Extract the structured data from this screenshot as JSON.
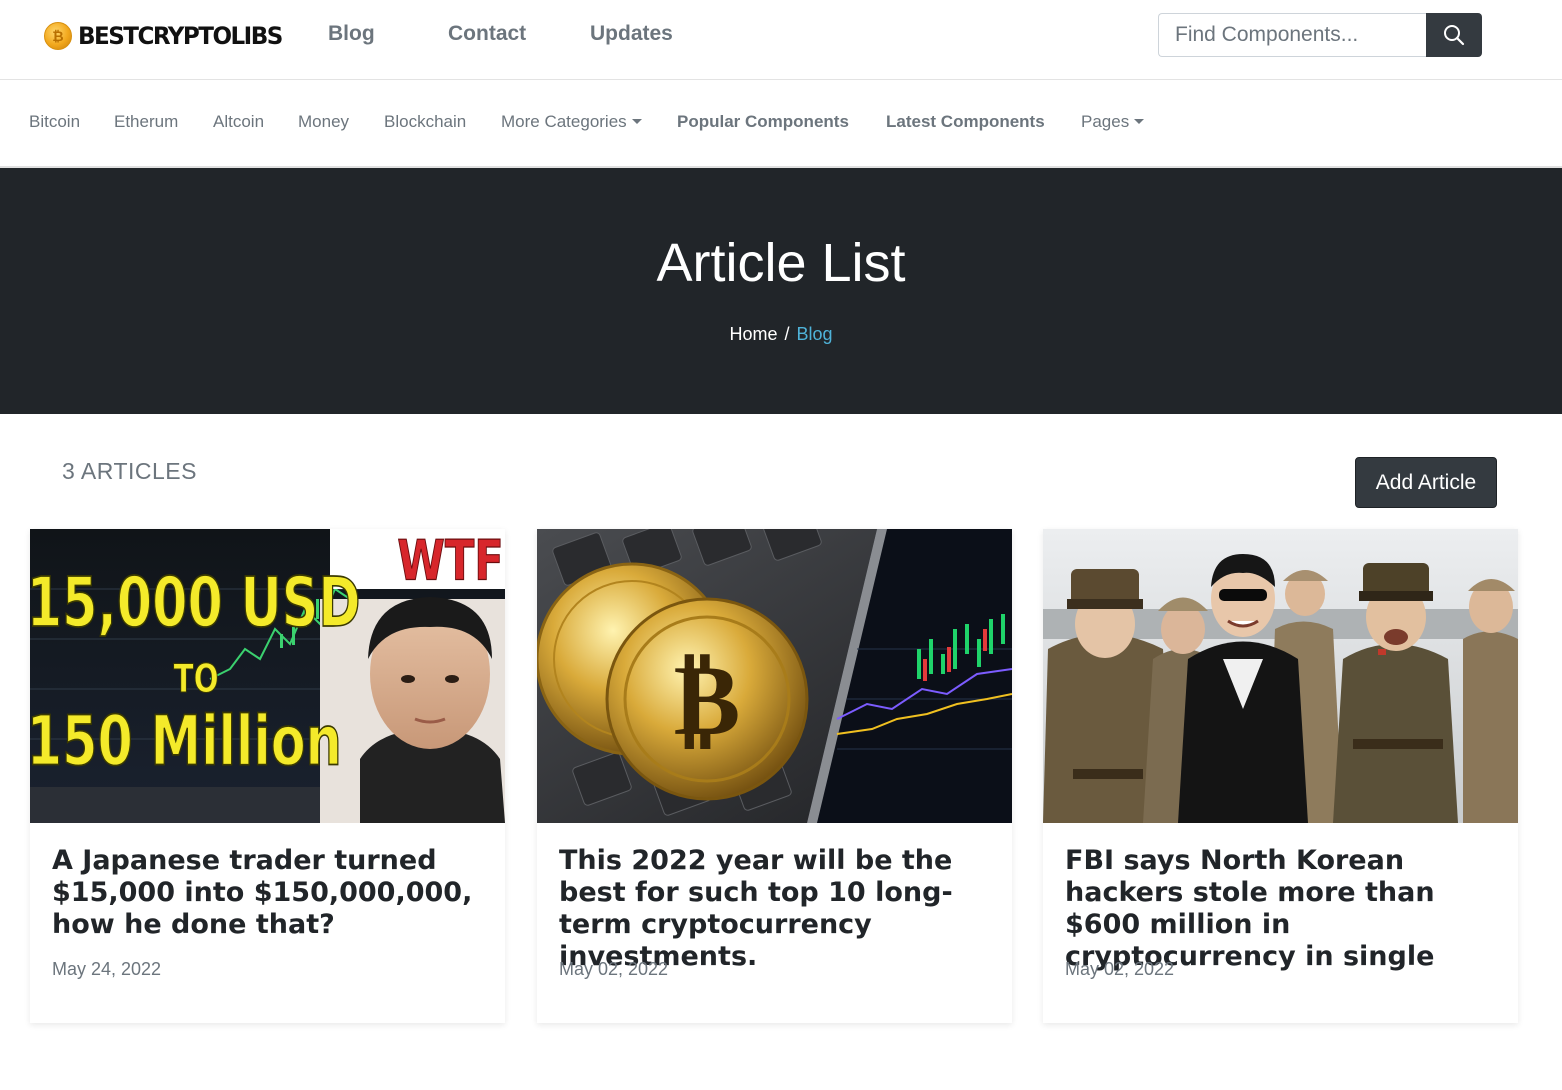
{
  "brand": {
    "name": "BESTCRYPTOLIBS",
    "coin_color": "#f2a81d"
  },
  "topnav": [
    {
      "label": "Blog"
    },
    {
      "label": "Contact"
    },
    {
      "label": "Updates"
    }
  ],
  "search": {
    "placeholder": "Find Components...",
    "value": "",
    "icon": "search-icon"
  },
  "catnav": [
    {
      "label": "Bitcoin"
    },
    {
      "label": "Etherum"
    },
    {
      "label": "Altcoin"
    },
    {
      "label": "Money"
    },
    {
      "label": "Blockchain"
    },
    {
      "label": "More Categories",
      "dropdown": true
    },
    {
      "label": "Popular Components"
    },
    {
      "label": "Latest Components"
    },
    {
      "label": "Pages",
      "dropdown": true
    }
  ],
  "hero": {
    "title": "Article List",
    "breadcrumb": {
      "home": "Home",
      "separator": "/",
      "current": "Blog"
    },
    "background": "#212529",
    "link_color": "#4fb3d9"
  },
  "articles_header": {
    "count_label": "3 ARTICLES",
    "add_button": "Add Article"
  },
  "articles": [
    {
      "title": "A Japanese trader turned $15,000 into $150,000,000, how he done that?",
      "date": "May 24, 2022",
      "image_text": {
        "line1": "15,000 USD",
        "line2": "TO",
        "line3": "150 Million",
        "tag": "WTF?!"
      }
    },
    {
      "title": "This 2022 year will be the best for such top 10 long-term cryptocurrency investments.",
      "date": "May 02, 2022"
    },
    {
      "title": "FBI says North Korean hackers stole more than $600 million in cryptocurrency in single",
      "date": "May 02, 2022"
    }
  ]
}
